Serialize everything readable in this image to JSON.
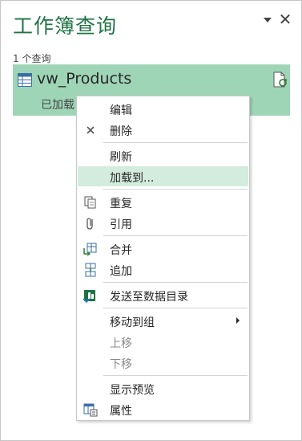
{
  "pane": {
    "title": "工作簿查询",
    "query_count": "1 个查询"
  },
  "query": {
    "name": "vw_Products",
    "status": "已加载"
  },
  "menu": {
    "edit": "编辑",
    "delete": "删除",
    "refresh": "刷新",
    "load_to": "加载到...",
    "duplicate": "重复",
    "reference": "引用",
    "merge": "合并",
    "append": "追加",
    "send_to_catalog": "发送至数据目录",
    "move_to_group": "移动到组",
    "move_up": "上移",
    "move_down": "下移",
    "show_preview": "显示预览",
    "properties": "属性"
  },
  "colors": {
    "title_green": "#217346",
    "selected_row": "#9fd5b7",
    "menu_hover": "#d3ecdd"
  }
}
